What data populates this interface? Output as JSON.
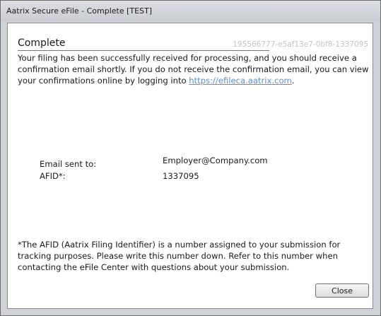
{
  "window": {
    "title": "Aatrix Secure eFile - Complete [TEST]"
  },
  "header": {
    "title": "Complete",
    "filing_id": "195566777-e5af13e7-0bf8-1337095"
  },
  "message": {
    "text_before_link": "Your filing has been successfully received for processing, and you should receive a confirmation email shortly. If you do not receive the confirmation email, you can view your confirmations online by logging into ",
    "link_text": "https://efileca.aatrix.com",
    "text_after_link": "."
  },
  "details": {
    "email_label": "Email sent to:",
    "email_value": "Employer@Company.com",
    "afid_label": "AFID*:",
    "afid_value": "1337095"
  },
  "footnote": {
    "text": "*The AFID (Aatrix Filing Identifier) is a number assigned to your submission for tracking purposes. Please write this number down. Refer to this number when contacting the eFile Center with questions about your submission."
  },
  "buttons": {
    "close_label": "Close"
  }
}
